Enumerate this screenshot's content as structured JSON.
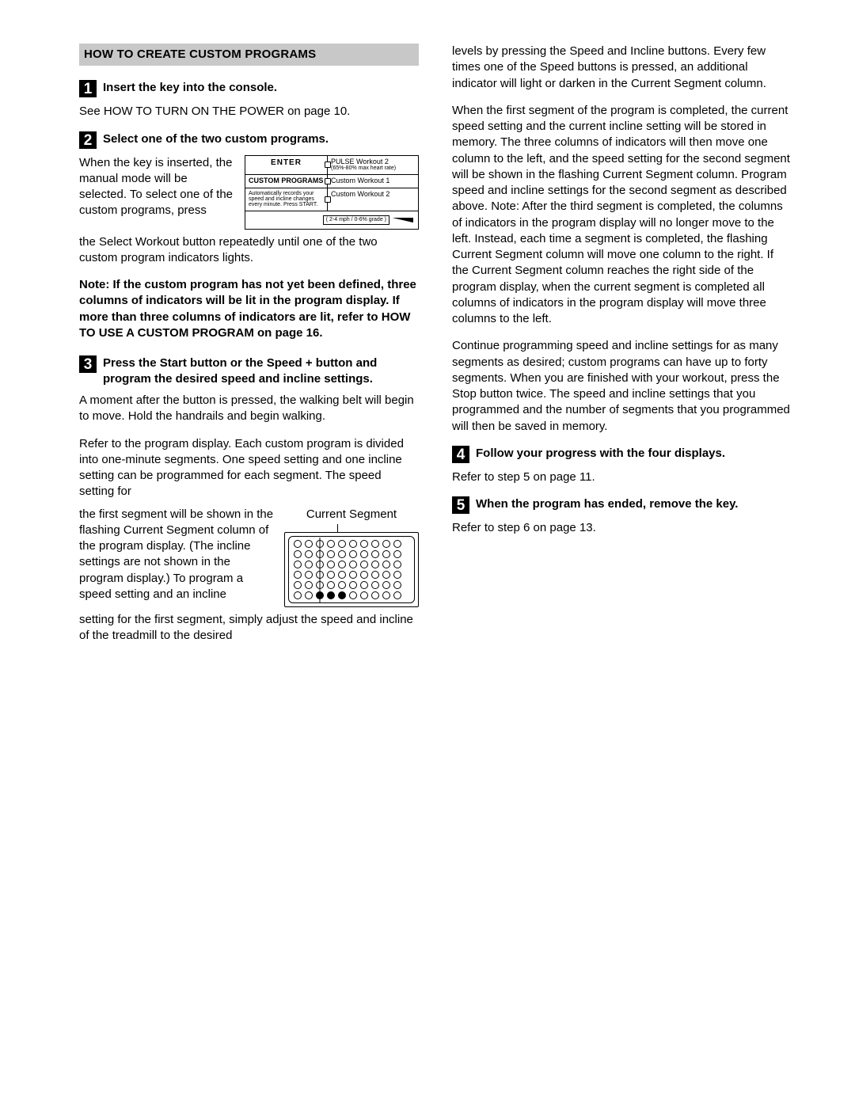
{
  "heading": "HOW TO CREATE CUSTOM PROGRAMS",
  "steps": {
    "s1": {
      "num": "1",
      "title": "Insert the key into the console.",
      "body": "See HOW TO TURN ON THE POWER on page 10."
    },
    "s2": {
      "num": "2",
      "title": "Select one of the two custom programs.",
      "intro": "When the key is inserted, the manual mode will be selected. To select one of the custom programs, press",
      "rest": "the Select Workout button repeatedly until one of the two custom program indicators lights.",
      "note": "Note: If the custom program has not yet been defined, three columns of indicators will be lit in the program display. If more than three columns of indicators are lit, refer to HOW TO USE A CUSTOM PROGRAM on page 16.",
      "fig": {
        "enter": "ENTER",
        "pulse_label": "PULSE Workout 2",
        "pulse_sub": "(65%-80% max heart rate)",
        "cp_header": "CUSTOM PROGRAMS",
        "cp_desc": "Automatically records your speed and incline changes every minute. Press START.",
        "cw1": "Custom Workout 1",
        "cw2": "Custom Workout 2",
        "scale": "( 2-4 mph / 0-6% grade )"
      }
    },
    "s3": {
      "num": "3",
      "title": "Press the Start button or the Speed + button and program the desired speed and incline settings.",
      "p1": "A moment after the button is pressed, the walking belt will begin to move. Hold the handrails and begin walking.",
      "p2a": "Refer to the program display. Each custom program is divided into one-minute segments. One speed setting and one incline setting can be programmed for each segment. The speed setting for",
      "p2b": "the first segment will be shown in the flashing Current Segment column of the program display. (The incline settings are not shown in the program display.) To program a speed setting and an incline",
      "p2c": "setting for the first segment, simply adjust the speed and incline of the treadmill to the desired",
      "cs_label": "Current Segment"
    },
    "right_top": "levels by pressing the Speed and Incline buttons. Every few times one of the Speed buttons is pressed, an additional indicator will light or darken in the Current Segment column.",
    "right_mid": "When the first segment of the program is completed, the current speed setting and the current incline setting will be stored in memory. The three columns of indicators will then move one column to the left, and the speed setting for the second segment will be shown in the flashing Current Segment column. Program speed and incline settings for the second segment as described above. Note: After the third segment is completed, the columns of indicators in the program display will no longer move to the left. Instead, each time a segment is completed, the flashing Current Segment column will move one column to the right. If the Current Segment column reaches the right side of the program display, when the current segment is completed all columns of indicators in the program display will move three columns to the left.",
    "right_bot": "Continue programming speed and incline settings for as many segments as desired; custom programs can have up to forty segments. When you are finished with your workout, press the Stop button twice. The speed and incline settings that you programmed and the number of segments that you programmed will then be saved in memory.",
    "s4": {
      "num": "4",
      "title": "Follow your progress with the four displays.",
      "body": "Refer to step 5 on page 11."
    },
    "s5": {
      "num": "5",
      "title": "When the program has ended, remove the key.",
      "body": "Refer to step 6 on page 13."
    }
  }
}
